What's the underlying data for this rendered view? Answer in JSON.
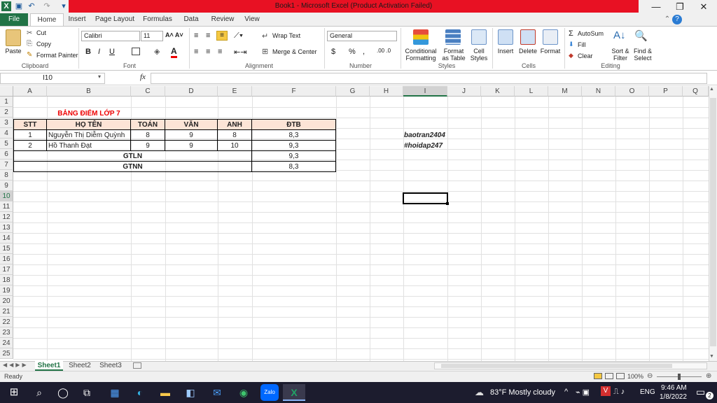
{
  "window": {
    "title": "Book1 - Microsoft Excel (Product Activation Failed)",
    "minimize": "—",
    "restore": "❐",
    "close": "✕",
    "help": "?"
  },
  "tabs": [
    "File",
    "Home",
    "Insert",
    "Page Layout",
    "Formulas",
    "Data",
    "Review",
    "View"
  ],
  "ribbon": {
    "clipboard": {
      "paste": "Paste",
      "cut": "Cut",
      "copy": "Copy",
      "format_painter": "Format Painter",
      "label": "Clipboard"
    },
    "font": {
      "name": "Calibri",
      "size": "11",
      "bold": "B",
      "italic": "I",
      "underline": "U",
      "label": "Font"
    },
    "alignment": {
      "wrap": "Wrap Text",
      "merge": "Merge & Center",
      "label": "Alignment"
    },
    "number": {
      "format": "General",
      "currency": "$",
      "percent": "%",
      "comma": ",",
      "label": "Number"
    },
    "styles": {
      "conditional": "Conditional",
      "conditional2": "Formatting",
      "format_table": "Format",
      "format_table2": "as Table",
      "cell_styles": "Cell",
      "cell_styles2": "Styles",
      "label": "Styles"
    },
    "cells": {
      "insert": "Insert",
      "delete": "Delete",
      "format": "Format",
      "label": "Cells"
    },
    "editing": {
      "autosum": "AutoSum",
      "fill": "Fill",
      "clear": "Clear",
      "sort": "Sort &",
      "sort2": "Filter",
      "find": "Find &",
      "find2": "Select",
      "label": "Editing"
    }
  },
  "formula_bar": {
    "name_box": "I10",
    "fx": "fx",
    "value": ""
  },
  "columns": [
    "A",
    "B",
    "C",
    "D",
    "E",
    "F",
    "G",
    "H",
    "I",
    "J",
    "K",
    "L",
    "M",
    "N",
    "O",
    "P",
    "Q"
  ],
  "rows": [
    "1",
    "2",
    "3",
    "4",
    "5",
    "6",
    "7",
    "8",
    "9",
    "10",
    "11",
    "12",
    "13",
    "14",
    "15",
    "16",
    "17",
    "18",
    "19",
    "20",
    "21",
    "22",
    "23",
    "24",
    "25"
  ],
  "sheet": {
    "title": "BẢNG ĐIỂM LỚP 7",
    "headers": [
      "STT",
      "HỌ TÊN",
      "TOÁN",
      "VĂN",
      "ANH",
      "ĐTB"
    ],
    "rows": [
      [
        "1",
        "Nguyễn Thị Diễm Quỳnh",
        "8",
        "9",
        "8",
        "8,3"
      ],
      [
        "2",
        "Hồ Thanh Đạt",
        "9",
        "9",
        "10",
        "9,3"
      ]
    ],
    "gtln_label": "GTLN",
    "gtln_value": "9,3",
    "gtnn_label": "GTNN",
    "gtnn_value": "8,3",
    "note1": "baotran2404",
    "note2": "#hoidap247"
  },
  "sheet_tabs": [
    "Sheet1",
    "Sheet2",
    "Sheet3"
  ],
  "status": {
    "ready": "Ready",
    "zoom": "100%"
  },
  "taskbar": {
    "weather": "83°F  Mostly cloudy",
    "lang": "ENG",
    "time": "9:46 AM",
    "date": "1/8/2022",
    "notif": "2"
  }
}
